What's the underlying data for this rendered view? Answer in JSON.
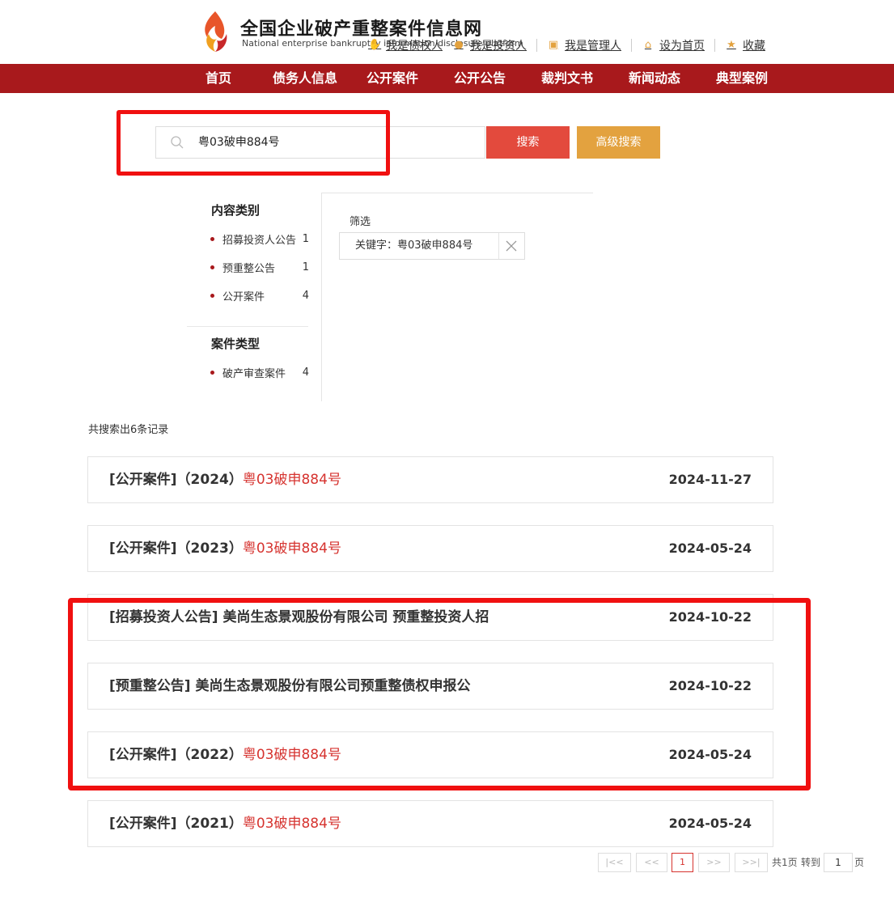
{
  "header": {
    "site_title": "全国企业破产重整案件信息网",
    "site_subtitle": "National enterprise bankruptcy information disclosure platform",
    "links": [
      {
        "label": "我是债权人",
        "icon": "handshake-icon"
      },
      {
        "label": "我是投资人",
        "icon": "coin-icon"
      },
      {
        "label": "我是管理人",
        "icon": "badge-icon"
      },
      {
        "label": "设为首页",
        "icon": "home-icon"
      },
      {
        "label": "收藏",
        "icon": "star-icon"
      }
    ]
  },
  "nav": {
    "items": [
      "首页",
      "债务人信息",
      "公开案件",
      "公开公告",
      "裁判文书",
      "新闻动态",
      "典型案例"
    ]
  },
  "search": {
    "value": "粤03破申884号",
    "search_button": "搜索",
    "advanced_button": "高级搜索"
  },
  "sidebar": {
    "content_heading": "内容类别",
    "content_items": [
      {
        "label": "招募投资人公告",
        "count": "1"
      },
      {
        "label": "预重整公告",
        "count": "1"
      },
      {
        "label": "公开案件",
        "count": "4"
      }
    ],
    "case_heading": "案件类型",
    "case_items": [
      {
        "label": "破产审查案件",
        "count": "4"
      }
    ]
  },
  "filter": {
    "label": "筛选",
    "chip": "关键字：粤03破申884号"
  },
  "results": {
    "count_text": "共搜索出6条记录",
    "items": [
      {
        "prefix": "[公开案件]（2024）",
        "highlight": "粤03破申884号",
        "date": "2024-11-27"
      },
      {
        "prefix": "[公开案件]（2023）",
        "highlight": "粤03破申884号",
        "date": "2024-05-24"
      },
      {
        "prefix": "[招募投资人公告] 美尚生态景观股份有限公司 预重整投资人招",
        "highlight": "",
        "date": "2024-10-22"
      },
      {
        "prefix": "[预重整公告] 美尚生态景观股份有限公司预重整债权申报公",
        "highlight": "",
        "date": "2024-10-22"
      },
      {
        "prefix": "[公开案件]（2022）",
        "highlight": "粤03破申884号",
        "date": "2024-05-24"
      },
      {
        "prefix": "[公开案件]（2021）",
        "highlight": "粤03破申884号",
        "date": "2024-05-24"
      }
    ]
  },
  "pagination": {
    "first": "|<<",
    "prev": "<<",
    "current": "1",
    "next": ">>",
    "last": ">>|",
    "total_text": "共1页",
    "goto_text": "转到",
    "goto_value": "1",
    "page_suffix": "页"
  },
  "colors": {
    "nav_bg": "#a8191c",
    "search_button": "#e34a3d",
    "advanced_button": "#e3a23f",
    "highlight_text": "#d6332f",
    "annotation_box": "#f01010"
  }
}
